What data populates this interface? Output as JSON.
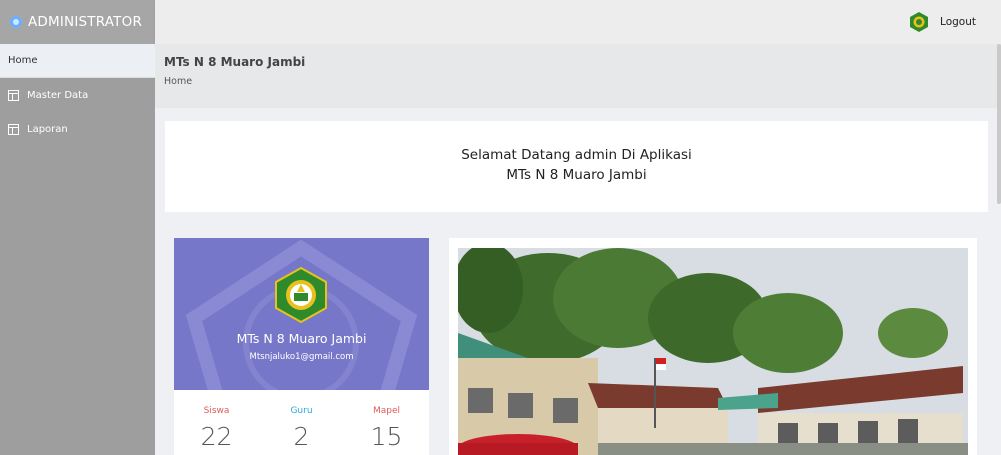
{
  "sidebar": {
    "brand": "ADMINISTRATOR",
    "items": [
      {
        "label": "Home",
        "icon": "none"
      },
      {
        "label": "Master Data",
        "icon": "table-icon"
      },
      {
        "label": "Laporan",
        "icon": "table-icon"
      }
    ]
  },
  "topbar": {
    "logout_label": "Logout"
  },
  "header": {
    "title": "MTs N 8 Muaro Jambi",
    "breadcrumb": "Home"
  },
  "welcome": {
    "line1": "Selamat Datang admin Di Aplikasi",
    "line2": "MTs N 8 Muaro Jambi"
  },
  "profile": {
    "name": "MTs N 8 Muaro Jambi",
    "email": "Mtsnjaluko1@gmail.com",
    "stats": [
      {
        "label": "Siswa",
        "value": "22",
        "color": "#e05a5a"
      },
      {
        "label": "Guru",
        "value": "2",
        "color": "#2aa8e0"
      },
      {
        "label": "Mapel",
        "value": "15",
        "color": "#e05a5a"
      }
    ]
  },
  "colors": {
    "sidebar": "#9e9e9e",
    "profile_header": "#7777c9",
    "logo_green": "#2f8a2b",
    "logo_gold": "#e7c21c"
  }
}
